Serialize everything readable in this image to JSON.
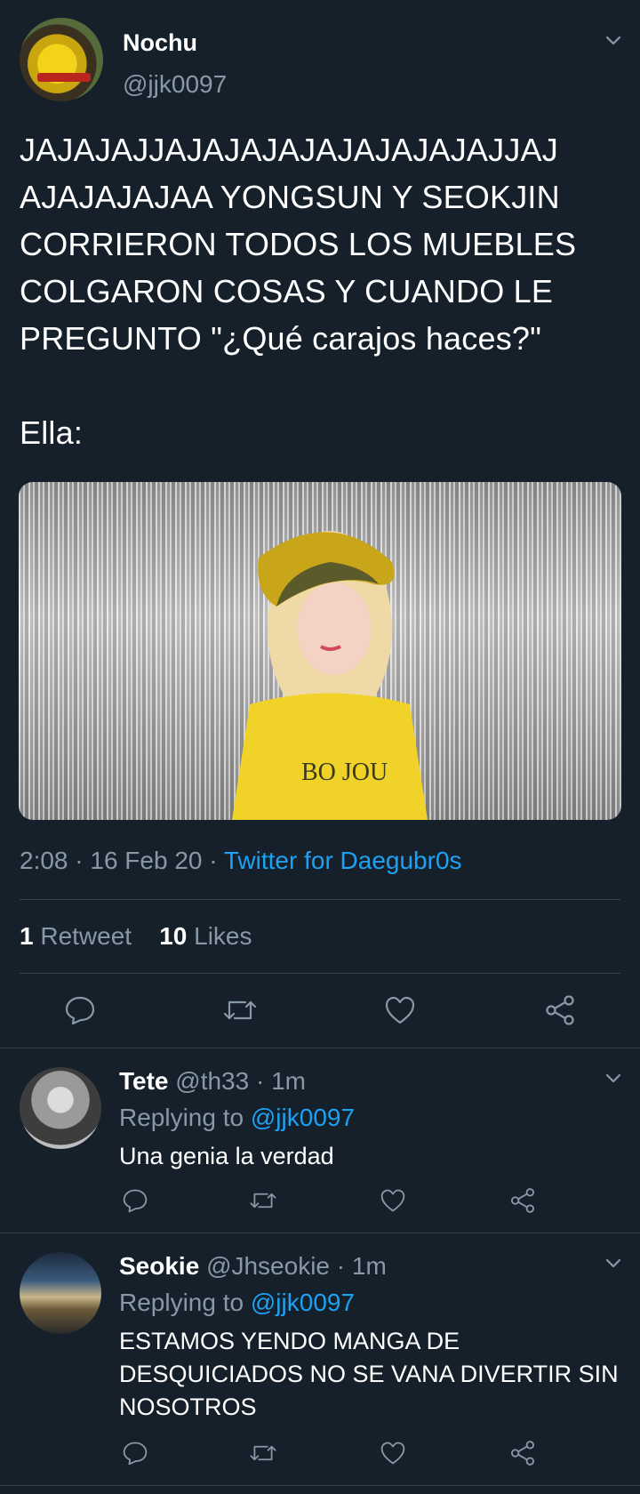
{
  "tweet": {
    "name": "Nochu",
    "handle": "@jjk0097",
    "text": "JAJAJAJJAJAJAJAJAJAJAJAJAJJAJ AJAJAJAJAA YONGSUN Y SEOKJIN CORRIERON TODOS LOS MUEBLES COLGARON COSAS Y CUANDO LE PREGUNTO \"¿Qué carajos haces?\"\n\nElla:",
    "time": "2:08 · 16 Feb 20 · ",
    "source": "Twitter for Daegubr0s",
    "retweets_count": "1",
    "retweets_label": "Retweet",
    "likes_count": "10",
    "likes_label": "Likes",
    "image_alt": "BO JOU"
  },
  "actions": [
    "reply-icon",
    "retweet-icon",
    "like-icon",
    "share-icon"
  ],
  "replies": [
    {
      "name": "Tete",
      "handle": "@th33 · 1m",
      "replying_prefix": "Replying to ",
      "replying_to": "@jjk0097",
      "text": "Una genia la verdad"
    },
    {
      "name": "Seokie",
      "handle": "@Jhseokie · 1m",
      "replying_prefix": "Replying to ",
      "replying_to": "@jjk0097",
      "text": "ESTAMOS YENDO MANGA DE DESQUICIADOS NO SE VANA DIVERTIR SIN NOSOTROS"
    }
  ],
  "colors": {
    "background": "#15202b",
    "secondary_text": "#8899a6",
    "link": "#1da1f2",
    "divider": "#38444d"
  }
}
